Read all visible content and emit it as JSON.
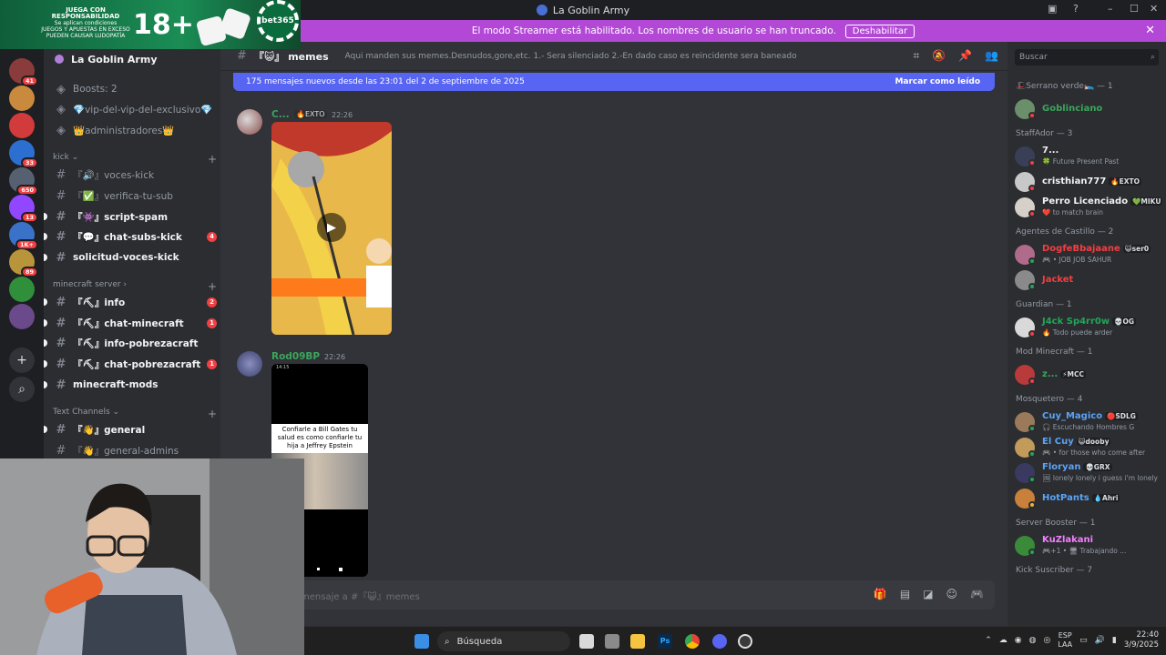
{
  "window": {
    "title": "La Goblin Army",
    "wc_min": "–",
    "wc_max": "☐",
    "wc_close": "✕",
    "help": "?"
  },
  "ad": {
    "line1": "JUEGA CON RESPONSABILIDAD",
    "line2": "Se aplican condiciones",
    "line3": "JUEGOS Y APUESTAS EN EXCESO",
    "line4": "PUEDEN CAUSAR LUDOPATÍA",
    "age": "18+",
    "brand": "bet365"
  },
  "banner": {
    "text": "El modo Streamer está habilitado. Los nombres de usuario se han truncado.",
    "button": "Deshabilitar",
    "close": "✕"
  },
  "rail": {
    "servers": [
      {
        "badge": "41",
        "color": "#8a3b3b"
      },
      {
        "badge": "",
        "color": "#c98a3e"
      },
      {
        "badge": "",
        "color": "#d13b3b"
      },
      {
        "badge": "33",
        "color": "#2d6fd1"
      },
      {
        "badge": "650",
        "color": "#556070"
      },
      {
        "badge": "13",
        "color": "#9146ff"
      },
      {
        "badge": "1K+",
        "color": "#3b72c9"
      },
      {
        "badge": "89",
        "color": "#b8953b"
      },
      {
        "badge": "",
        "color": "#2f8f3a"
      },
      {
        "badge": "",
        "color": "#6a4a8a"
      }
    ],
    "add": "+",
    "discover": "⌕"
  },
  "channels": {
    "guild_name": "La Goblin Army",
    "items": [
      {
        "type": "info",
        "label": "Boosts: 2",
        "unread": false,
        "badge": ""
      },
      {
        "type": "info",
        "label": "💎vip-del-vip-del-exclusivo💎",
        "unread": false,
        "badge": ""
      },
      {
        "type": "info",
        "label": "👑administradores👑",
        "unread": false,
        "badge": ""
      },
      {
        "type": "cat",
        "label": "kick ⌄"
      },
      {
        "type": "ch",
        "label": "『🔊』voces-kick",
        "unread": false,
        "badge": ""
      },
      {
        "type": "ch",
        "label": "『✅』verifica-tu-sub",
        "unread": false,
        "badge": ""
      },
      {
        "type": "ch",
        "label": "『👾』script-spam",
        "unread": true,
        "badge": ""
      },
      {
        "type": "ch",
        "label": "『💬』chat-subs-kick",
        "unread": true,
        "badge": "4"
      },
      {
        "type": "ch",
        "label": "solicitud-voces-kick",
        "unread": true,
        "badge": "",
        "nohashicon": true
      },
      {
        "type": "cat",
        "label": "minecraft server ›"
      },
      {
        "type": "ch",
        "label": "『⛏』info",
        "unread": true,
        "badge": "2"
      },
      {
        "type": "ch",
        "label": "『⛏』chat-minecraft",
        "unread": true,
        "badge": "1"
      },
      {
        "type": "ch",
        "label": "『⛏』info-pobrezacraft",
        "unread": true,
        "badge": ""
      },
      {
        "type": "ch",
        "label": "『⛏』chat-pobrezacraft",
        "unread": true,
        "badge": "1"
      },
      {
        "type": "ch",
        "label": "minecraft-mods",
        "unread": true,
        "badge": "",
        "nohashicon": true
      },
      {
        "type": "cat",
        "label": "Text Channels ⌄"
      },
      {
        "type": "ch",
        "label": "『👋』general",
        "unread": true,
        "badge": ""
      },
      {
        "type": "ch",
        "label": "『👋』general-admins",
        "unread": false,
        "badge": ""
      }
    ]
  },
  "header": {
    "channel_prefix": "『😺』",
    "channel": "memes",
    "topic": "Aqui manden sus memes.Desnudos,gore,etc. 1.- Sera silenciado 2.-En dado caso es reincidente sera baneado"
  },
  "newbar": {
    "text": "175 mensajes nuevos desde las 23:01 del 2 de septiembre de 2025",
    "action": "Marcar como leído"
  },
  "messages": [
    {
      "user": "C...",
      "tag": "🔥EXTO",
      "time": "22:26",
      "user_color": "#3ba55c"
    },
    {
      "user": "Rod09BP",
      "tag": "",
      "time": "22:26",
      "user_color": "#3ba55c",
      "meme_text": "Confiarle a Bill Gates tu salud es como confiarle tu hija a Jeffrey Epstein",
      "phone_time": "14:15"
    }
  ],
  "composer": {
    "placeholder": "mensaje a #『😺』memes"
  },
  "search": {
    "placeholder": "Buscar"
  },
  "members": {
    "groups": [
      {
        "role": "🎩Serrano verde🛌 — 1",
        "people": [
          {
            "name": "Goblinciano",
            "sub": "",
            "tag": "",
            "color": "#3ba55c",
            "status": "#f23f42"
          }
        ]
      },
      {
        "role": "StaffAdor — 3",
        "people": [
          {
            "name": "7...",
            "sub": "🍀 Future Present Past",
            "tag": "",
            "color": "#f2f3f5",
            "status": "#f23f42"
          },
          {
            "name": "cristhian777",
            "sub": "",
            "tag": "🔥EXTO",
            "color": "#f2f3f5",
            "status": "#f23f42"
          },
          {
            "name": "Perro Licenciado",
            "sub": "❤️ to match brain",
            "tag": "💚MIKU",
            "color": "#f2f3f5",
            "status": "#f23f42"
          }
        ]
      },
      {
        "role": "Agentes de Castillo — 2",
        "people": [
          {
            "name": "DogfeBbajaane",
            "sub": "🎮 • JOB JOB SAHUR",
            "tag": "😺ser0",
            "color": "#f23f42",
            "status": "#23a559"
          },
          {
            "name": "Jacket",
            "sub": "",
            "tag": "",
            "color": "#f23f42",
            "status": "#23a559"
          }
        ]
      },
      {
        "role": "Guardian — 1",
        "people": [
          {
            "name": "J4ck Sp4rr0w",
            "sub": "🔥 Todo puede arder",
            "tag": "💀OG",
            "color": "#23a559",
            "status": "#f23f42"
          }
        ]
      },
      {
        "role": "Mod Minecraft — 1",
        "people": [
          {
            "name": "z...",
            "sub": "",
            "tag": "⚡MCC",
            "color": "#3ba55c",
            "status": "#f23f42"
          }
        ]
      },
      {
        "role": "Mosquetero — 4",
        "people": [
          {
            "name": "Cuy_Magico",
            "sub": "🎧 Escuchando Hombres G",
            "tag": "🔴SDLG",
            "color": "#5ba3f5",
            "status": "#23a559"
          },
          {
            "name": "El Cuy",
            "sub": "🎮 • for those who come after",
            "tag": "😺dooby",
            "color": "#5ba3f5",
            "status": "#23a559"
          },
          {
            "name": "Floryan",
            "sub": "🖼 lonely lonely i guess i'm lonely",
            "tag": "💀GRX",
            "color": "#5ba3f5",
            "status": "#23a559"
          },
          {
            "name": "HotPants",
            "sub": "",
            "tag": "💧Ahri",
            "color": "#5ba3f5",
            "status": "#f0b232"
          }
        ]
      },
      {
        "role": "Server Booster — 1",
        "people": [
          {
            "name": "KuZlakani",
            "sub": "🎮+1 • 🖥 Trabajando ...",
            "tag": "",
            "color": "#f47fff",
            "status": "#23a559"
          }
        ]
      },
      {
        "role": "Kick Suscriber — 7",
        "people": []
      }
    ]
  },
  "taskbar": {
    "search": "Búsqueda",
    "lang1": "ESP",
    "lang2": "LAA",
    "time": "22:40",
    "date": "3/9/2025"
  }
}
